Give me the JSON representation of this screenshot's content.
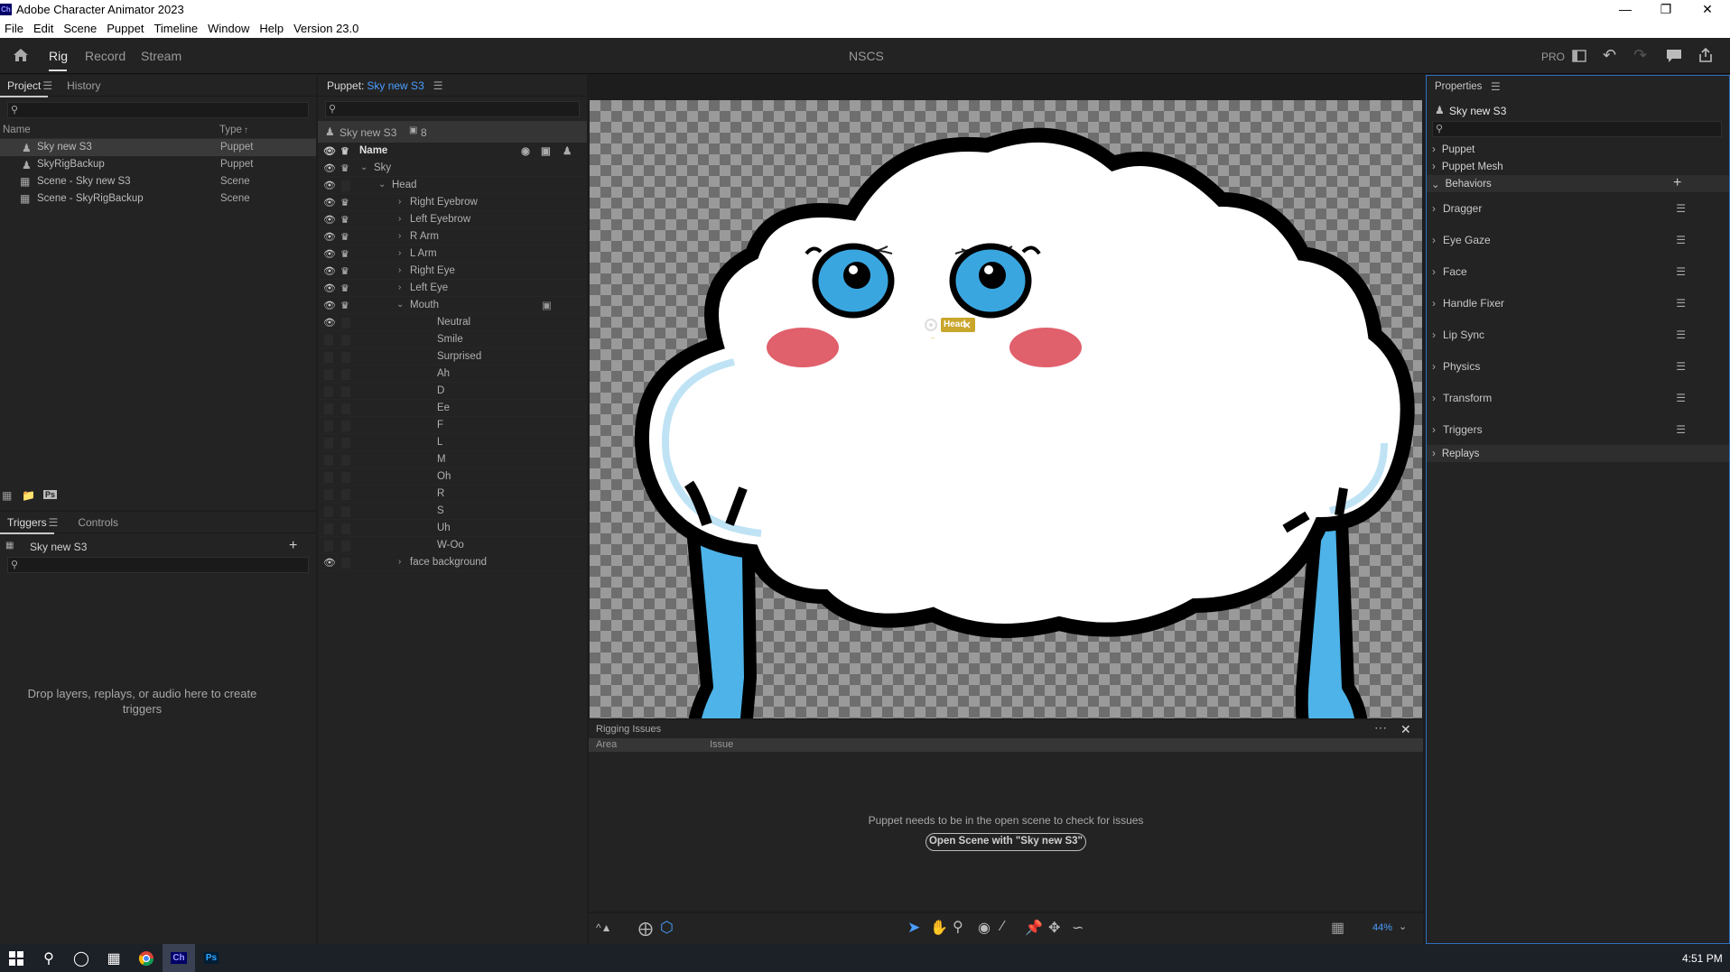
{
  "window": {
    "app_badge": "Ch",
    "title": "Adobe Character Animator 2023"
  },
  "menu": [
    "File",
    "Edit",
    "Scene",
    "Puppet",
    "Timeline",
    "Window",
    "Help",
    "Version 23.0"
  ],
  "workspace": {
    "tabs": [
      "Rig",
      "Record",
      "Stream"
    ],
    "active_tab": "Rig",
    "center_title": "NSCS",
    "pro_label": "PRO"
  },
  "project": {
    "tabs": [
      "Project",
      "History"
    ],
    "columns": [
      "Name",
      "Type"
    ],
    "items": [
      {
        "name": "Sky new S3",
        "type": "Puppet"
      },
      {
        "name": "SkyRigBackup",
        "type": "Puppet"
      },
      {
        "name": "Scene - Sky new S3",
        "type": "Scene"
      },
      {
        "name": "Scene - SkyRigBackup",
        "type": "Scene"
      }
    ],
    "ps_badge": "Ps"
  },
  "triggers": {
    "tabs": [
      "Triggers",
      "Controls"
    ],
    "puppet_name": "Sky new S3",
    "empty_text": "Drop layers, replays, or audio here to create triggers"
  },
  "puppet_panel": {
    "header_label": "Puppet:",
    "header_name": "Sky new S3",
    "puppet_name": "Sky new S3",
    "count": "8",
    "name_col": "Name",
    "layers": [
      {
        "name": "Sky"
      },
      {
        "name": "Head"
      },
      {
        "name": "Right Eyebrow"
      },
      {
        "name": "Left Eyebrow"
      },
      {
        "name": "R Arm"
      },
      {
        "name": "L Arm"
      },
      {
        "name": "Right Eye"
      },
      {
        "name": "Left Eye"
      },
      {
        "name": "Mouth"
      },
      {
        "name": "Neutral"
      },
      {
        "name": "Smile"
      },
      {
        "name": "Surprised"
      },
      {
        "name": "Ah"
      },
      {
        "name": "D"
      },
      {
        "name": "Ee"
      },
      {
        "name": "F"
      },
      {
        "name": "L"
      },
      {
        "name": "M"
      },
      {
        "name": "Oh"
      },
      {
        "name": "R"
      },
      {
        "name": "S"
      },
      {
        "name": "Uh"
      },
      {
        "name": "W-Oo"
      },
      {
        "name": "face background"
      }
    ]
  },
  "stage": {
    "handle_label": "Head",
    "zoom": "44%"
  },
  "rigging": {
    "title": "Rigging Issues",
    "columns": [
      "Area",
      "Issue"
    ],
    "message": "Puppet needs to be in the open scene to check for issues",
    "button": "Open Scene with \"Sky new S3\""
  },
  "properties": {
    "title": "Properties",
    "puppet_name": "Sky new S3",
    "sections": [
      "Puppet",
      "Puppet Mesh",
      "Behaviors"
    ],
    "behaviors": [
      "Dragger",
      "Eye Gaze",
      "Face",
      "Handle Fixer",
      "Lip Sync",
      "Physics",
      "Transform",
      "Triggers"
    ],
    "replays": "Replays"
  },
  "taskbar": {
    "time": "4:51 PM",
    "ch_badge": "Ch",
    "ps_badge": "Ps"
  }
}
